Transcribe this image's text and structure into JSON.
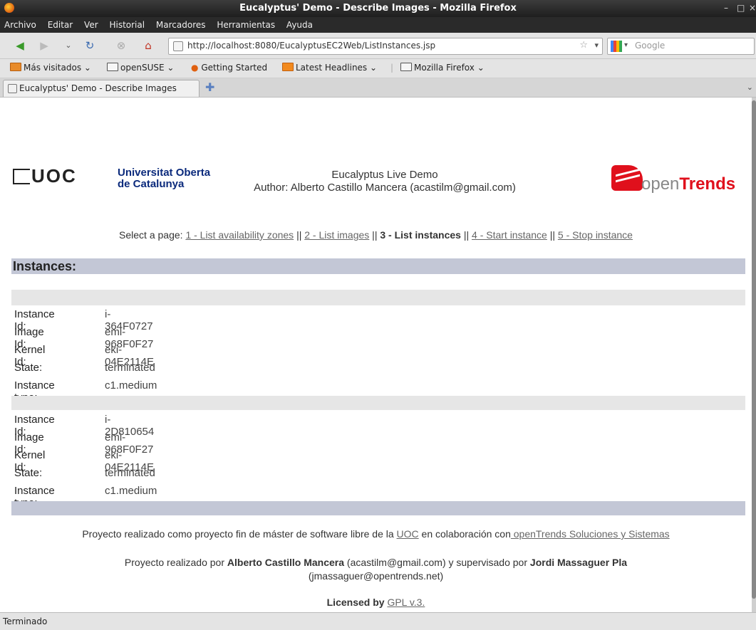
{
  "window": {
    "title": "Eucalyptus' Demo - Describe Images - Mozilla Firefox"
  },
  "menu": [
    "Archivo",
    "Editar",
    "Ver",
    "Historial",
    "Marcadores",
    "Herramientas",
    "Ayuda"
  ],
  "nav": {
    "url": "http://localhost:8080/EucalyptusEC2Web/ListInstances.jsp",
    "search_placeholder": "Google"
  },
  "bookmarks": [
    "Más visitados",
    "openSUSE",
    "Getting Started",
    "Latest Headlines",
    "Mozilla Firefox"
  ],
  "tab": {
    "label": "Eucalyptus' Demo - Describe Images"
  },
  "page": {
    "logo_uoc": "UOC",
    "uni_line1": "Universitat Oberta",
    "uni_line2": "de Catalunya",
    "demo_title": "Eucalyptus Live Demo",
    "author": "Author: Alberto Castillo Mancera (acastilm@gmail.com)",
    "logo_open": "open",
    "logo_trends": "Trends",
    "select_prefix": "Select a page:",
    "links": [
      "1 - List availability zones",
      "2 - List images",
      "3 - List instances",
      "4 - Start instance",
      "5 - Stop instance"
    ],
    "section_title": "Instances:",
    "labels": {
      "instance_id": "Instance Id:",
      "image_id": "Image Id:",
      "kernel_id": "Kernel Id:",
      "state": "State:",
      "instance_type": "Instance type:"
    },
    "instances": [
      {
        "instance_id": "i-364F0727",
        "image_id": "emi-968F0F27",
        "kernel_id": "eki-04E2114E",
        "state": "terminated",
        "instance_type": "c1.medium"
      },
      {
        "instance_id": "i-2D810654",
        "image_id": "emi-968F0F27",
        "kernel_id": "eki-04E2114E",
        "state": "terminated",
        "instance_type": "c1.medium"
      }
    ],
    "footer": {
      "l1_a": "Proyecto realizado como proyecto fin de máster de software libre de la ",
      "l1_uoc": "UOC",
      "l1_b": " en colaboración con",
      "l1_ot": " openTrends Soluciones y Sistemas",
      "l2_a": "Proyecto realizado por ",
      "l2_name1": "Alberto Castillo Mancera",
      "l2_b": " (acastilm@gmail.com) y supervisado por ",
      "l2_name2": "Jordi Massaguer Pla",
      "l2_c": "(jmassaguer@opentrends.net)",
      "lic_a": "Licensed by",
      "lic_link": "GPL v.3."
    }
  },
  "status": "Terminado"
}
